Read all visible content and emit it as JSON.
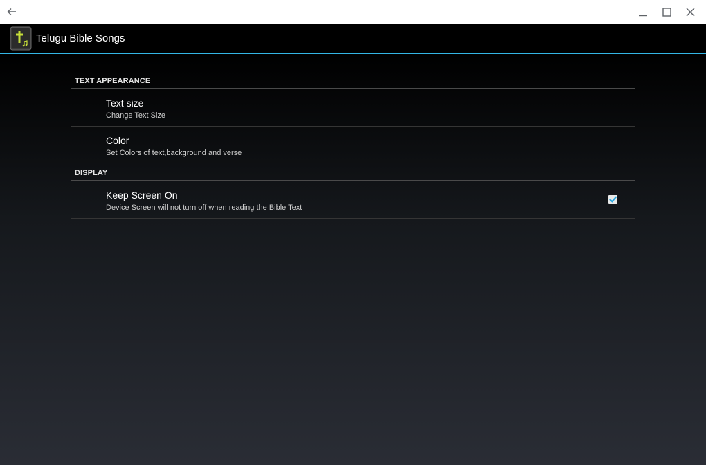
{
  "app": {
    "title": "Telugu Bible Songs"
  },
  "window_controls": {
    "back_icon": "arrow-left-icon",
    "minimize_icon": "minimize-icon",
    "maximize_icon": "maximize-icon",
    "close_icon": "close-icon"
  },
  "preferences": {
    "categories": [
      {
        "header": "TEXT APPEARANCE",
        "items": [
          {
            "title": "Text size",
            "summary": "Change Text Size"
          },
          {
            "title": "Color",
            "summary": "Set Colors of text,background and verse"
          }
        ]
      },
      {
        "header": "DISPLAY",
        "items": [
          {
            "title": "Keep Screen On",
            "summary": "Device Screen will not turn off when reading the Bible Text",
            "checked": true
          }
        ]
      }
    ]
  },
  "colors": {
    "accent": "#33b5e5",
    "check": "#29a8e0",
    "icon_green": "#c6de3a"
  }
}
